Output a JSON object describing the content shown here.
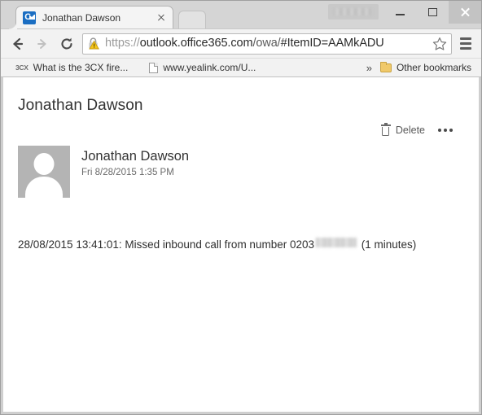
{
  "window": {
    "controls": {
      "minimize_label": "Minimize",
      "maximize_label": "Maximize",
      "close_label": "Close",
      "user_chip_label": ""
    }
  },
  "browser": {
    "tab": {
      "title": "Jonathan Dawson",
      "favicon": "outlook-favicon",
      "close_label": "×"
    },
    "new_tab_label": "",
    "nav": {
      "back_label": "Back",
      "forward_label": "Forward",
      "reload_label": "Reload"
    },
    "omnibox": {
      "security_icon": "warning-padlock-icon",
      "url_scheme": "https://",
      "url_domain": "outlook.office365.com",
      "url_path": "/owa/",
      "url_fragment": "#ItemID=AAMkADU",
      "bookmark_icon": "star-icon"
    },
    "menu_label": "Customize and control",
    "bookmarks": {
      "items": [
        {
          "icon": "3cx-icon",
          "label": "What is the 3CX fire..."
        },
        {
          "icon": "page-icon",
          "label": "www.yealink.com/U..."
        }
      ],
      "overflow_label": "»",
      "other_label": "Other bookmarks",
      "other_icon": "folder-icon"
    }
  },
  "mail": {
    "subject": "Jonathan Dawson",
    "commands": {
      "delete_label": "Delete",
      "delete_icon": "trash-icon",
      "more_label": "More actions",
      "more_icon": "ellipsis-icon"
    },
    "sender": {
      "name": "Jonathan Dawson",
      "date": "Fri 8/28/2015 1:35 PM",
      "avatar_icon": "person-avatar-icon"
    },
    "body": {
      "prefix": "28/08/2015 13:41:01: Missed inbound call from number 0203",
      "redacted": "",
      "suffix": " (1 minutes)"
    }
  },
  "colors": {
    "accent": "#1b6ec2",
    "chrome_bg": "#f2f2f2",
    "text": "#333333",
    "avatar_bg": "#b4b4b4"
  }
}
